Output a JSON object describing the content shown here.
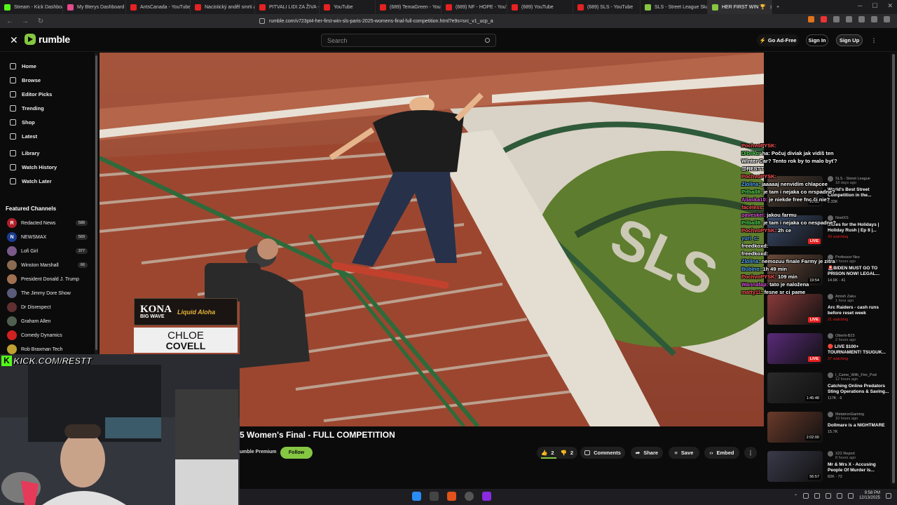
{
  "browser": {
    "tabs": [
      {
        "title": "Stream - Kick Dashboard",
        "color": "#53fc18"
      },
      {
        "title": "My Bterys Dashboard",
        "color": "#e34b8a"
      },
      {
        "title": "AntsCanada - YouTube",
        "color": "#e62121"
      },
      {
        "title": "Nacistický anděl smrti a jeho",
        "color": "#e62121"
      },
      {
        "title": "PITVALI LIDI ZA ŽIVA - Jeho",
        "color": "#e62121"
      },
      {
        "title": "YouTube",
        "color": "#e62121"
      },
      {
        "title": "(689) TemaGreen - YouTube",
        "color": "#e62121"
      },
      {
        "title": "(689) NF - HOPE - YouTube",
        "color": "#e62121"
      },
      {
        "title": "(689) YouTube",
        "color": "#e62121"
      },
      {
        "title": "(689) SLS - YouTube",
        "color": "#e62121"
      },
      {
        "title": "SLS - Street League Skatebo",
        "color": "#85c742"
      },
      {
        "title": "HER FIRST WIN 🏆",
        "color": "#85c742",
        "active": true
      }
    ],
    "url": "rumble.com/v723pt4-her-first-win-sls-paris-2025-womens-final-full-competition.html?e9s=src_v1_ucp_a"
  },
  "header": {
    "logo": "rumble",
    "search_placeholder": "Search",
    "go_ad_free": "Go Ad-Free",
    "sign_in": "Sign In",
    "sign_up": "Sign Up"
  },
  "sidebar": {
    "nav": [
      "Home",
      "Browse",
      "Editor Picks",
      "Trending",
      "Shop",
      "Latest"
    ],
    "nav2": [
      "Library",
      "Watch History",
      "Watch Later"
    ],
    "featured_title": "Featured Channels",
    "channels": [
      {
        "name": "Redacted News",
        "count": "588",
        "initial": "R",
        "color": "#b0202a"
      },
      {
        "name": "NEWSMAX",
        "count": "569",
        "initial": "N",
        "color": "#1a3d8f"
      },
      {
        "name": "Lofi Girl",
        "count": "377",
        "initial": "",
        "color": "#7a5a8a"
      },
      {
        "name": "Winston Marshall",
        "count": "66",
        "initial": "",
        "color": "#8a6a50"
      },
      {
        "name": "President Donald J. Trump",
        "count": "",
        "initial": "",
        "color": "#a07050"
      },
      {
        "name": "The Jimmy Dore Show",
        "count": "",
        "initial": "",
        "color": "#5a5a7a"
      },
      {
        "name": "Dr Disrespect",
        "count": "",
        "initial": "",
        "color": "#603030"
      },
      {
        "name": "Graham Allen",
        "count": "",
        "initial": "",
        "color": "#506050"
      },
      {
        "name": "Comedy Dynamics",
        "count": "",
        "initial": "",
        "color": "#d02020"
      },
      {
        "name": "Rob Braxman Tech",
        "count": "",
        "initial": "",
        "color": "#c0a030"
      }
    ]
  },
  "overlay": {
    "kona_line1": "KONA",
    "kona_line2": "BIG WAVE",
    "kona_tag": "Liquid Aloha",
    "athlete_first": "CHLOE",
    "athlete_last": "COVELL",
    "kick_url": "KICK.COM/RESTT",
    "kick_k": "K"
  },
  "video_info": {
    "title": "5 Women's Final - FULL COMPETITION",
    "channel_badge": "umble Premium",
    "follow": "Follow",
    "likes": "2",
    "dislikes": "2",
    "comments": "Comments",
    "share": "Share",
    "save": "Save",
    "embed": "Embed"
  },
  "recommendations": [
    {
      "channel": "SLS - Street League",
      "ago": "18 days ago",
      "title": "World's Best Street Competition in the...",
      "stat": "2.33K",
      "duration": "26:50",
      "live": false,
      "color": "#4a3a30"
    },
    {
      "channel": "NoelXS",
      "ago": "",
      "title": "Indies for the Holidays | Holiday Rush | Ep 8 |...",
      "stat": "43 watching",
      "duration": "LIVE",
      "live": true,
      "color": "#3a4a6a"
    },
    {
      "channel": "Professor Nez",
      "ago": "3 hours ago",
      "title": "🚨BIDEN MUST GO TO PRISON NOW! LEGAL...",
      "stat": "14.6K  ·  41",
      "duration": "19:54",
      "live": false,
      "color": "#6a4a3a"
    },
    {
      "channel": "Amish Zaku",
      "ago": "1 hour ago",
      "title": "Arc Raiders - cash runs before reset week",
      "stat": "21 watching",
      "duration": "LIVE",
      "live": true,
      "color": "#8a3a3a"
    },
    {
      "channel": "Otterlii-B23",
      "ago": "2 hours ago",
      "title": "🔴 LIVE $100+ TOURNAMENT! TSUGUK...",
      "stat": "37 watching",
      "duration": "LIVE",
      "live": true,
      "color": "#5a2a7a"
    },
    {
      "channel": "I_Came_With_Fire_Pod",
      "ago": "12 hours ago",
      "title": "Catching Online Predators Sting Operations & Saving...",
      "stat": "117K  ·  6",
      "duration": "1:45:48",
      "live": false,
      "color": "#2a2a2a"
    },
    {
      "channel": "MetatronGaming",
      "ago": "10 hours ago",
      "title": "Dollmare is a NIGHTMARE",
      "stat": "15.7K",
      "duration": "2:02:00",
      "live": false,
      "color": "#6a3a2a"
    },
    {
      "channel": "X22 Report",
      "ago": "8 hours ago",
      "title": "Mr & Mrs X - Accusing People Of Murder Is...",
      "stat": "82K  ·  72",
      "duration": "56:57",
      "live": false,
      "color": "#3a3a4a"
    }
  ],
  "chat": [
    {
      "user": "PochvoPYSK:",
      "msg": "",
      "color": "#ff5555"
    },
    {
      "user": "Dibiiko:",
      "msg": "ha: Počuj diviak jak vidíš ten",
      "color": "#55dd55"
    },
    {
      "user": "",
      "msg": "Winter Car? Tento rok by to malo byť?",
      "color": "#ffffff"
    },
    {
      "user": "",
      "msg": "@RESTT",
      "color": "#ffffff"
    },
    {
      "user": "PochvoPYSK:",
      "msg": "",
      "color": "#ff5555"
    },
    {
      "user": "Zlolina:",
      "msg": "jaaaaaj nenvidím chlapcee",
      "color": "#55aaff"
    },
    {
      "user": "Pitball8:",
      "msg": "je tam i nejaka co nrspadne?",
      "color": "#55dd55"
    },
    {
      "user": "Aliaska10:",
      "msg": "je niekde free fnc či nie?",
      "color": "#dd55dd"
    },
    {
      "user": "faceless:",
      "msg": "",
      "color": "#ff5555"
    },
    {
      "user": "paveskel:",
      "msg": "jakou farmu",
      "color": "#dd55dd"
    },
    {
      "user": "Pitball8:",
      "msg": "je tam i nejaka co nespadne?",
      "color": "#55dd55"
    },
    {
      "user": "PochvoPYSK:",
      "msg": "2h ce",
      "color": "#ff5555"
    },
    {
      "user": "yuri_c:",
      "msg": "",
      "color": "#55aaff"
    },
    {
      "user": "freedkoxd:",
      "msg": "",
      "color": "#ffffff"
    },
    {
      "user": "freedkoxd:",
      "msg": "",
      "color": "#ffffff"
    },
    {
      "user": "Zlolina:",
      "msg": "nemozuu finale Farmy je zitra",
      "color": "#55aaff"
    },
    {
      "user": "Bubino:",
      "msg": "1h 49 min",
      "color": "#55aaff"
    },
    {
      "user": "PochvoPYSK:",
      "msg": "109 min",
      "color": "#ff5555"
    },
    {
      "user": "Wannafap:",
      "msg": "tato je naložena",
      "color": "#dd55dd"
    },
    {
      "user": "matty11:",
      "msg": "fesne sr ci pame",
      "color": "#ff5555"
    }
  ],
  "taskbar": {
    "time": "9:58 PM",
    "date": "12/13/2025"
  },
  "colors": {
    "accent": "#85c742",
    "live": "#e62121",
    "kick": "#53fc18"
  }
}
